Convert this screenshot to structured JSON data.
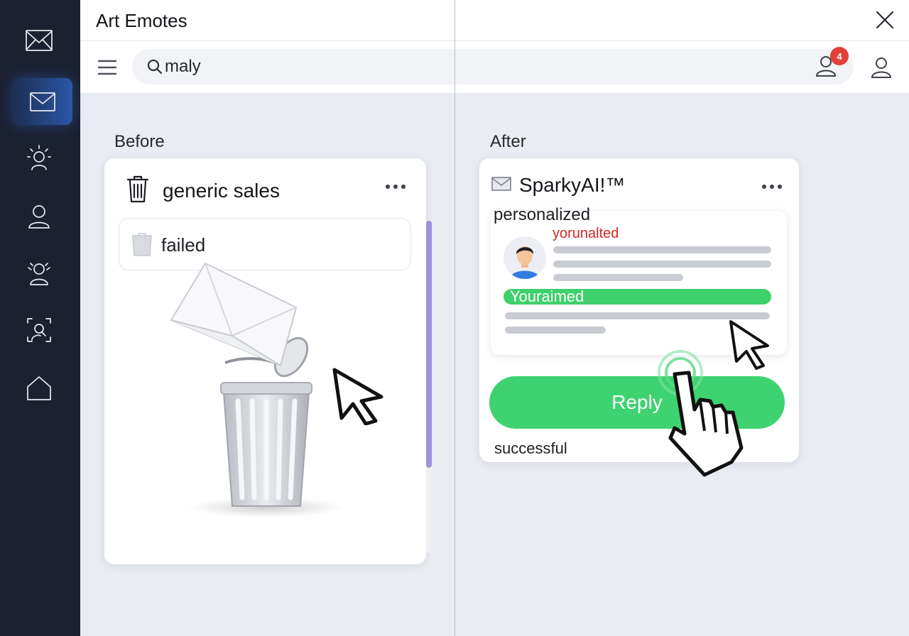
{
  "app": {
    "title": "Art Emotes"
  },
  "rail": {
    "items": [
      {
        "icon": "mail-icon",
        "active": false
      },
      {
        "icon": "mail-icon",
        "active": true
      },
      {
        "icon": "idea-person-icon",
        "active": false
      },
      {
        "icon": "person-icon",
        "active": false
      },
      {
        "icon": "group-icon",
        "active": false
      },
      {
        "icon": "scan-search-icon",
        "active": false
      },
      {
        "icon": "home-icon",
        "active": false
      }
    ]
  },
  "toolbar": {
    "search_value": "maly",
    "notification_count": "4"
  },
  "before": {
    "section_label": "Before",
    "card_title": "generic sales",
    "status_label": "failed"
  },
  "after": {
    "section_label": "After",
    "card_title": "SparkyAI!™",
    "tag_label": "personalized",
    "preview_name": "yorunalted",
    "highlight_text": "Youraimed",
    "reply_label": "Reply",
    "result_label": "successful"
  },
  "colors": {
    "rail_bg": "#1b2131",
    "accent_blue": "#2a56a6",
    "success_green": "#3ed370",
    "error_red": "#d7261f",
    "badge_red": "#e3403a",
    "scroll_purple": "#9e93dc"
  }
}
